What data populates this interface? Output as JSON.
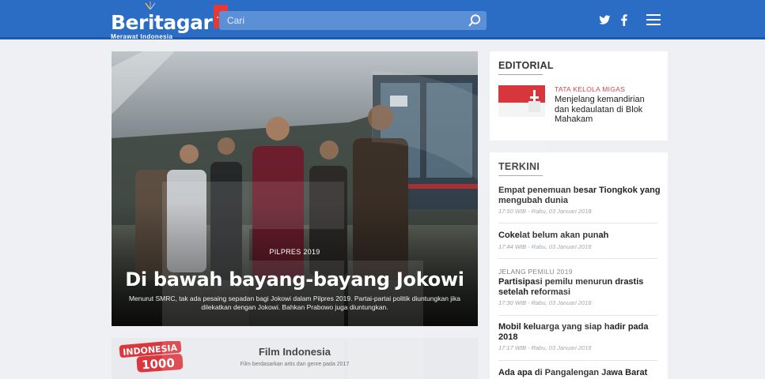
{
  "header": {
    "logo_text": "Beritagar",
    "logo_badge": ".id",
    "logo_tagline": "Merawat Indonesia",
    "search_placeholder": "Cari",
    "icons": [
      "search-icon",
      "twitter-icon",
      "facebook-icon",
      "menu-icon"
    ]
  },
  "hero": {
    "category": "PILPRES 2019",
    "title": "Di bawah bayang-bayang Jokowi",
    "description": "Menurut SMRC, tak ada pesaing sepadan bagi Jokowi dalam Pilpres 2019. Partai-partai politik diuntungkan jika dilekatkan dengan Jokowi. Bahkan Prabowo juga diuntungkan."
  },
  "film": {
    "logo_line1": "INDONESIA",
    "logo_line2": "1000",
    "title": "Film Indonesia",
    "subtitle": "Film berdasarkan artis dan genre pada 2017"
  },
  "editorial": {
    "heading": "EDITORIAL",
    "category": "TATA KELOLA MIGAS",
    "title": "Menjelang kemandirian dan kedaulatan di Blok Mahakam"
  },
  "terkini": {
    "heading": "TERKINI",
    "items": [
      {
        "category": "",
        "title": "Empat penemuan besar Tiongkok yang mengubah dunia",
        "time": "17:50 WIB - Rabu, 03 Januari 2018"
      },
      {
        "category": "",
        "title": "Cokelat belum akan punah",
        "time": "17:44 WIB - Rabu, 03 Januari 2018"
      },
      {
        "category": "JELANG PEMILU 2019",
        "title": "Partisipasi pemilu menurun drastis setelah reformasi",
        "time": "17:30 WIB - Rabu, 03 Januari 2018"
      },
      {
        "category": "",
        "title": "Mobil keluarga yang siap hadir pada 2018",
        "time": "17:17 WIB - Rabu, 03 Januari 2018"
      },
      {
        "category": "",
        "title": "Ada apa di Pangalengan Jawa Barat",
        "time": ""
      }
    ]
  },
  "colors": {
    "header_blue": "#2b6cc4",
    "accent_red": "#d64545",
    "background": "#eef0f4"
  }
}
